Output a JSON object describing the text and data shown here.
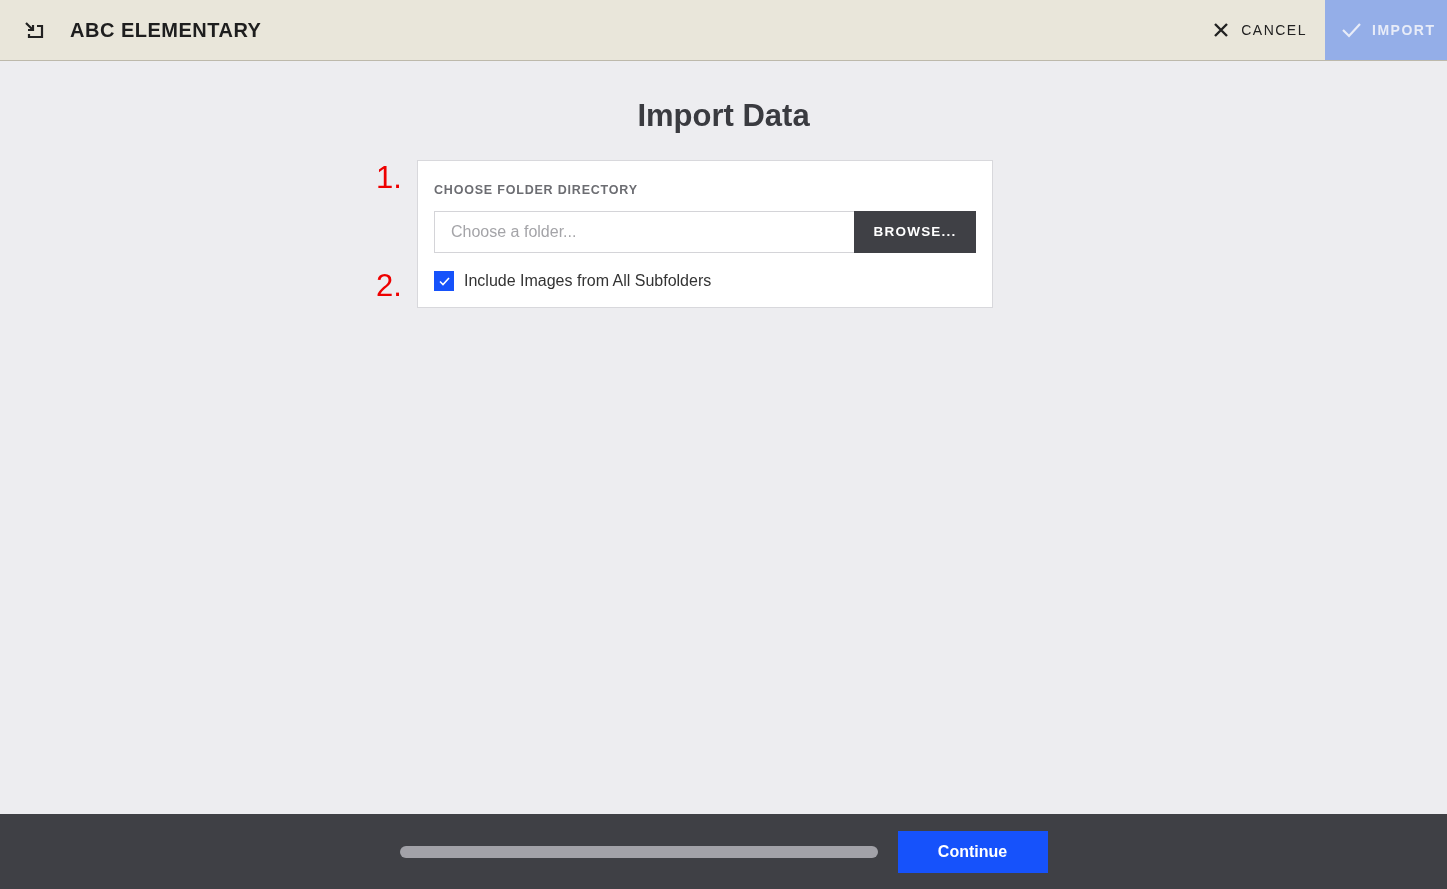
{
  "header": {
    "title": "ABC ELEMENTARY",
    "cancel": "CANCEL",
    "import": {
      "label": "IMPORT",
      "disabled": true
    }
  },
  "page_title": "Import Data",
  "steps": [
    "1.",
    "2."
  ],
  "folder": {
    "label": "CHOOSE FOLDER DIRECTORY",
    "placeholder": "Choose a folder...",
    "browse": "BROWSE..."
  },
  "subfolders": {
    "label": "Include Images from All Subfolders",
    "checked": true
  },
  "footer": {
    "progress": {
      "level": 0
    },
    "continue": "Continue"
  }
}
